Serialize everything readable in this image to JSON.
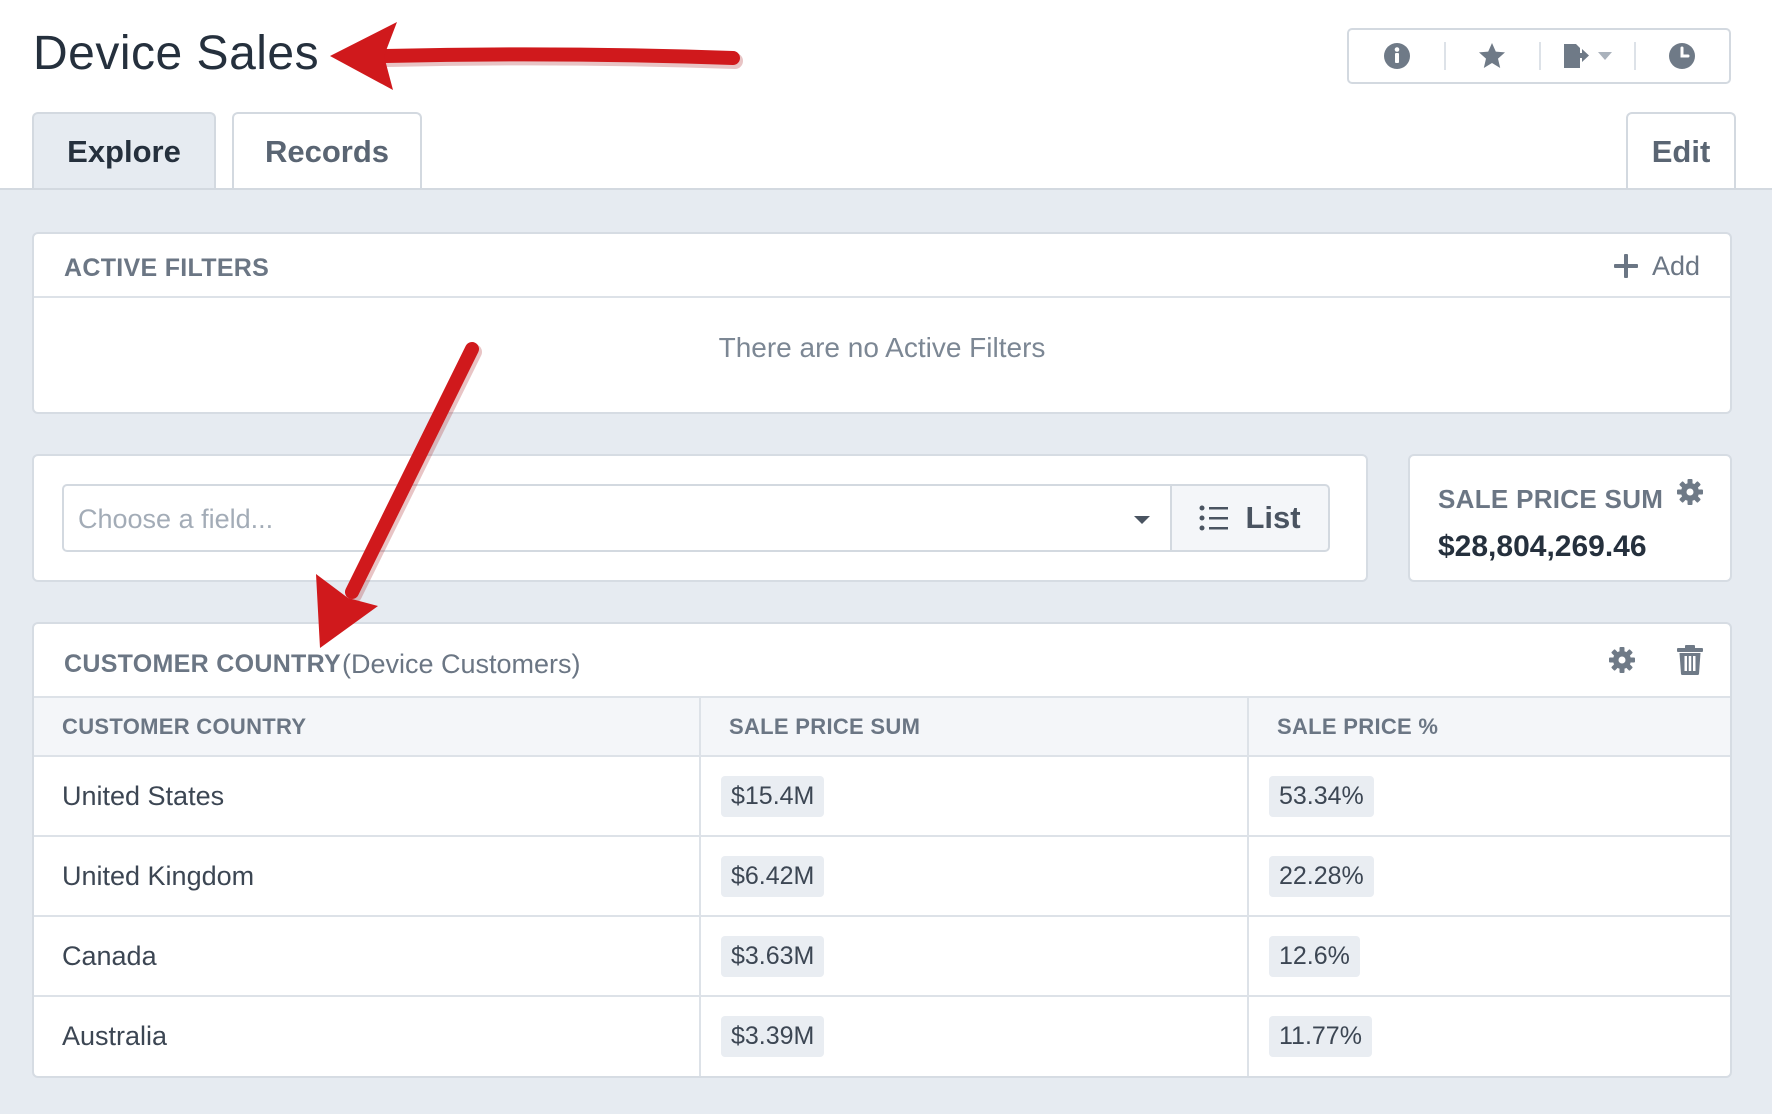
{
  "page": {
    "title": "Device Sales"
  },
  "toolbar": {
    "buttons": [
      {
        "name": "info",
        "icon": "info-circle-icon"
      },
      {
        "name": "favorite",
        "icon": "star-icon"
      },
      {
        "name": "export",
        "icon": "export-icon"
      },
      {
        "name": "history",
        "icon": "clock-icon"
      }
    ]
  },
  "tabs": {
    "explore": "Explore",
    "records": "Records",
    "edit": "Edit",
    "active": "Explore"
  },
  "filters": {
    "heading": "ACTIVE FILTERS",
    "add_label": "Add",
    "empty_message": "There are no Active Filters"
  },
  "field_picker": {
    "placeholder": "Choose a field...",
    "view_label": "List"
  },
  "summary": {
    "label": "SALE PRICE SUM",
    "value": "$28,804,269.46"
  },
  "breakdown": {
    "heading": "CUSTOMER COUNTRY",
    "subheading": "(Device Customers)",
    "columns": [
      "CUSTOMER COUNTRY",
      "SALE PRICE SUM",
      "SALE PRICE %"
    ],
    "rows": [
      {
        "country": "United States",
        "sum": "$15.4M",
        "percent": "53.34%"
      },
      {
        "country": "United Kingdom",
        "sum": "$6.42M",
        "percent": "22.28%"
      },
      {
        "country": "Canada",
        "sum": "$3.63M",
        "percent": "12.6%"
      },
      {
        "country": "Australia",
        "sum": "$3.39M",
        "percent": "11.77%"
      }
    ]
  },
  "colors": {
    "annotation_arrow": "#d0191c",
    "background": "#e6ebf1",
    "text_muted": "#6b7684"
  }
}
